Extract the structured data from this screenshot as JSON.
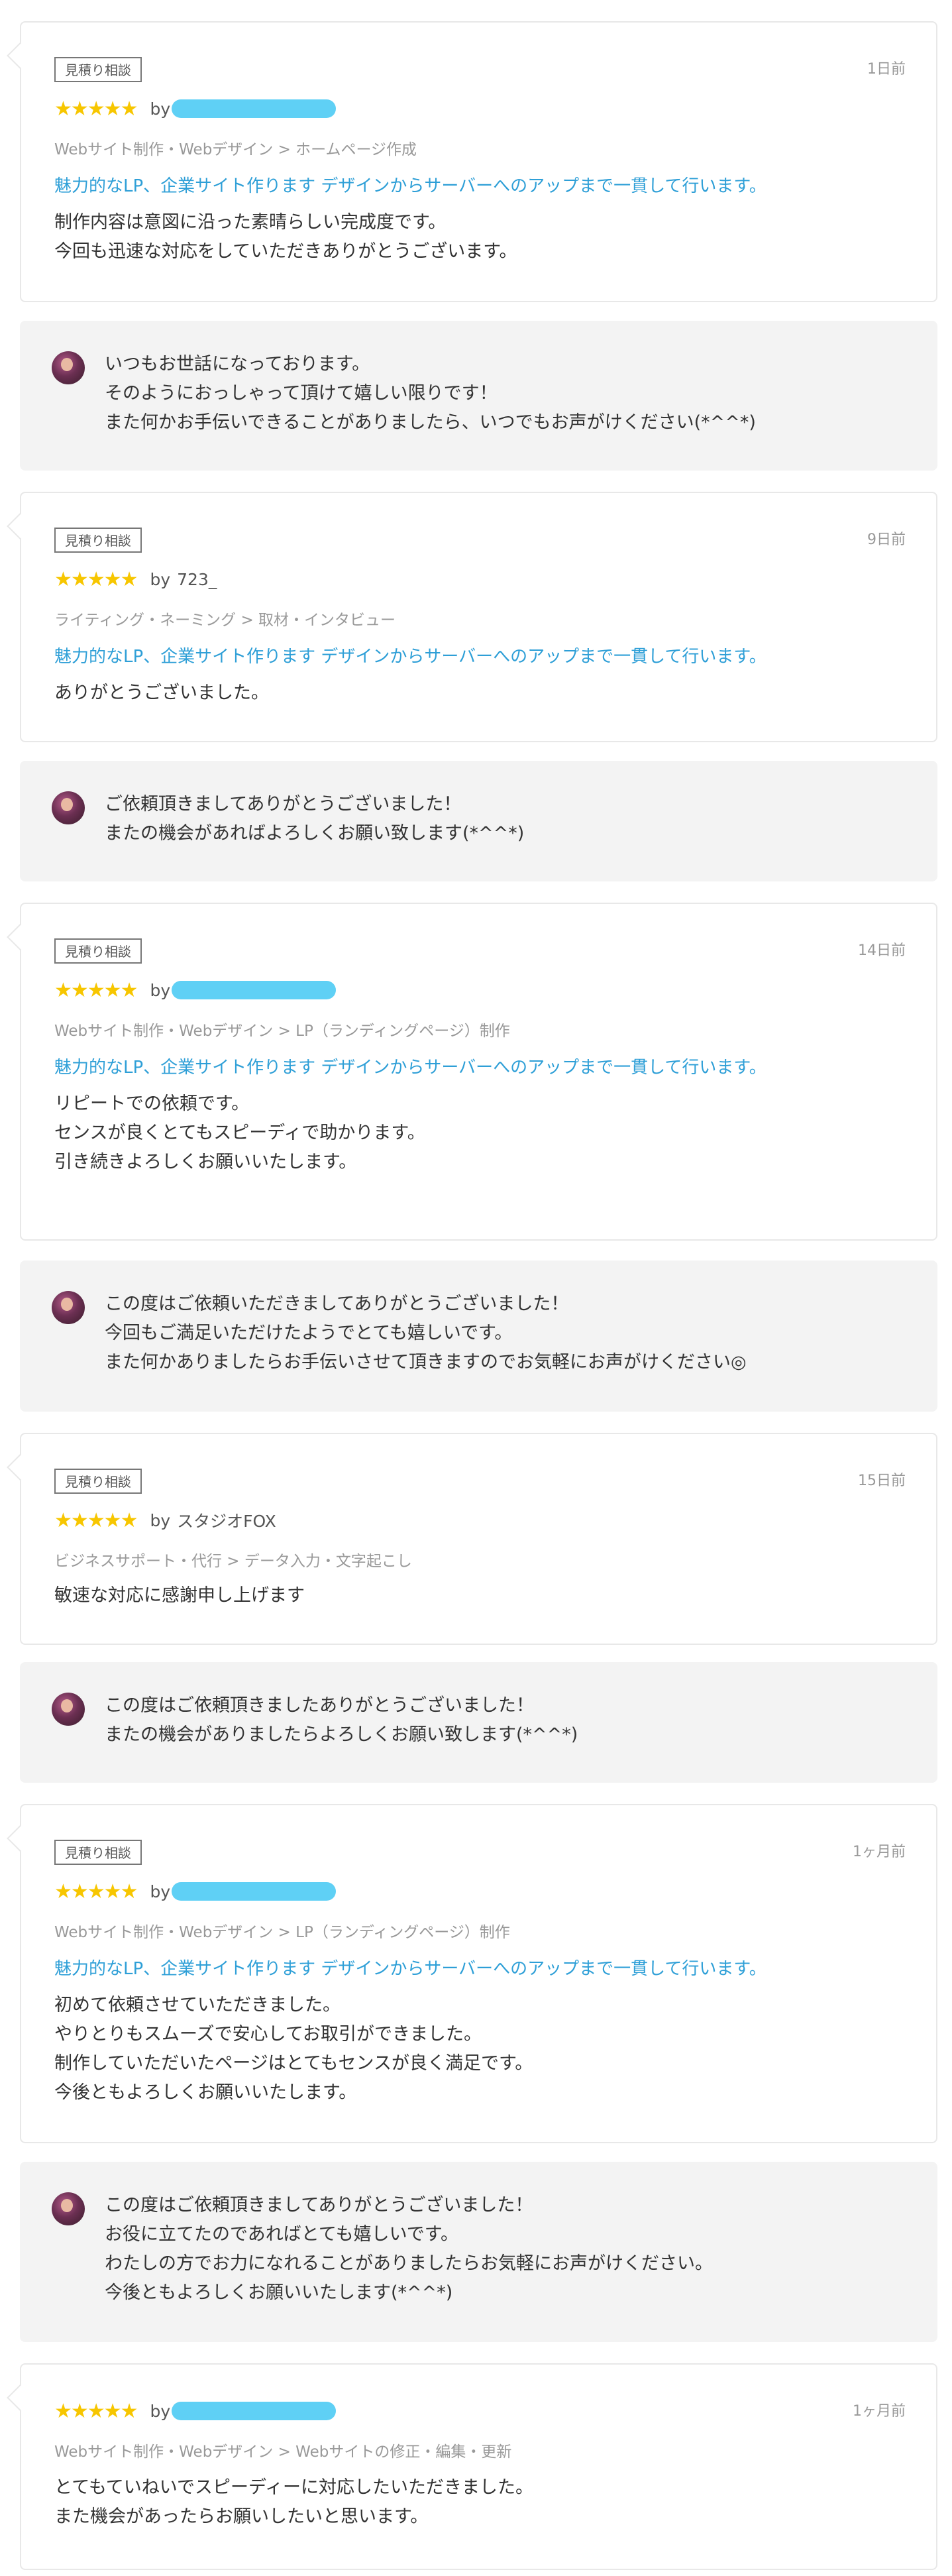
{
  "reviews": [
    {
      "badge": "見積り相談",
      "date": "1日前",
      "stars": "★★★★★",
      "by": "by",
      "reviewer": "",
      "category": "Webサイト制作・Webデザイン > ホームページ作成",
      "service": "魅力的なLP、企業サイト作ります デザインからサーバーへのアップまで一貫して行います。",
      "body": "制作内容は意図に沿った素晴らしい完成度です。\n今回も迅速な対応をしていただきありがとうございます。",
      "reply": "いつもお世話になっております。\nそのようにおっしゃって頂けて嬉しい限りです！\nまた何かお手伝いできることがありましたら、いつでもお声がけください(*^^*)"
    },
    {
      "badge": "見積り相談",
      "date": "9日前",
      "stars": "★★★★★",
      "by": "by",
      "reviewer": "723_",
      "category": "ライティング・ネーミング > 取材・インタビュー",
      "service": "魅力的なLP、企業サイト作ります デザインからサーバーへのアップまで一貫して行います。",
      "body": "ありがとうございました。",
      "reply": "ご依頼頂きましてありがとうございました！\nまたの機会があればよろしくお願い致します(*^^*)"
    },
    {
      "badge": "見積り相談",
      "date": "14日前",
      "stars": "★★★★★",
      "by": "by",
      "reviewer": "",
      "category": "Webサイト制作・Webデザイン > LP（ランディングページ）制作",
      "service": "魅力的なLP、企業サイト作ります デザインからサーバーへのアップまで一貫して行います。",
      "body": "リピートでの依頼です。\nセンスが良くとてもスピーディで助かります。\n引き続きよろしくお願いいたします。",
      "reply": "この度はご依頼いただきましてありがとうございました！\n今回もご満足いただけたようでとても嬉しいです。\nまた何かありましたらお手伝いさせて頂きますのでお気軽にお声がけください◎"
    },
    {
      "badge": "見積り相談",
      "date": "15日前",
      "stars": "★★★★★",
      "by": "by",
      "reviewer": "スタジオFOX",
      "category": "ビジネスサポート・代行 > データ入力・文字起こし",
      "service": "",
      "body": "敏速な対応に感謝申し上げます",
      "reply": "この度はご依頼頂きましたありがとうございました！\nまたの機会がありましたらよろしくお願い致します(*^^*)"
    },
    {
      "badge": "見積り相談",
      "date": "1ヶ月前",
      "stars": "★★★★★",
      "by": "by",
      "reviewer": "",
      "category": "Webサイト制作・Webデザイン > LP（ランディングページ）制作",
      "service": "魅力的なLP、企業サイト作ります デザインからサーバーへのアップまで一貫して行います。",
      "body": "初めて依頼させていただきました。\nやりとりもスムーズで安心してお取引ができました。\n制作していただいたページはとてもセンスが良く満足です。\n今後ともよろしくお願いいたします。",
      "reply": "この度はご依頼頂きましてありがとうございました！\nお役に立てたのであればとても嬉しいです。\nわたしの方でお力になれることがありましたらお気軽にお声がけください。\n今後ともよろしくお願いいたします(*^^*)"
    },
    {
      "badge": "",
      "date": "1ヶ月前",
      "stars": "★★★★★",
      "by": "by",
      "reviewer": "",
      "category": "Webサイト制作・Webデザイン > Webサイトの修正・編集・更新",
      "service": "",
      "body": "とてもていねいでスピーディーに対応したいただきました。\nまた機会があったらお願いしたいと思います。",
      "reply": ""
    }
  ],
  "colors": {
    "star": "#f7c600",
    "link": "#2e9fd7",
    "reply_bg": "#f3f3f3",
    "border": "#e8e8e8",
    "redaction": "#5fd0f5"
  }
}
